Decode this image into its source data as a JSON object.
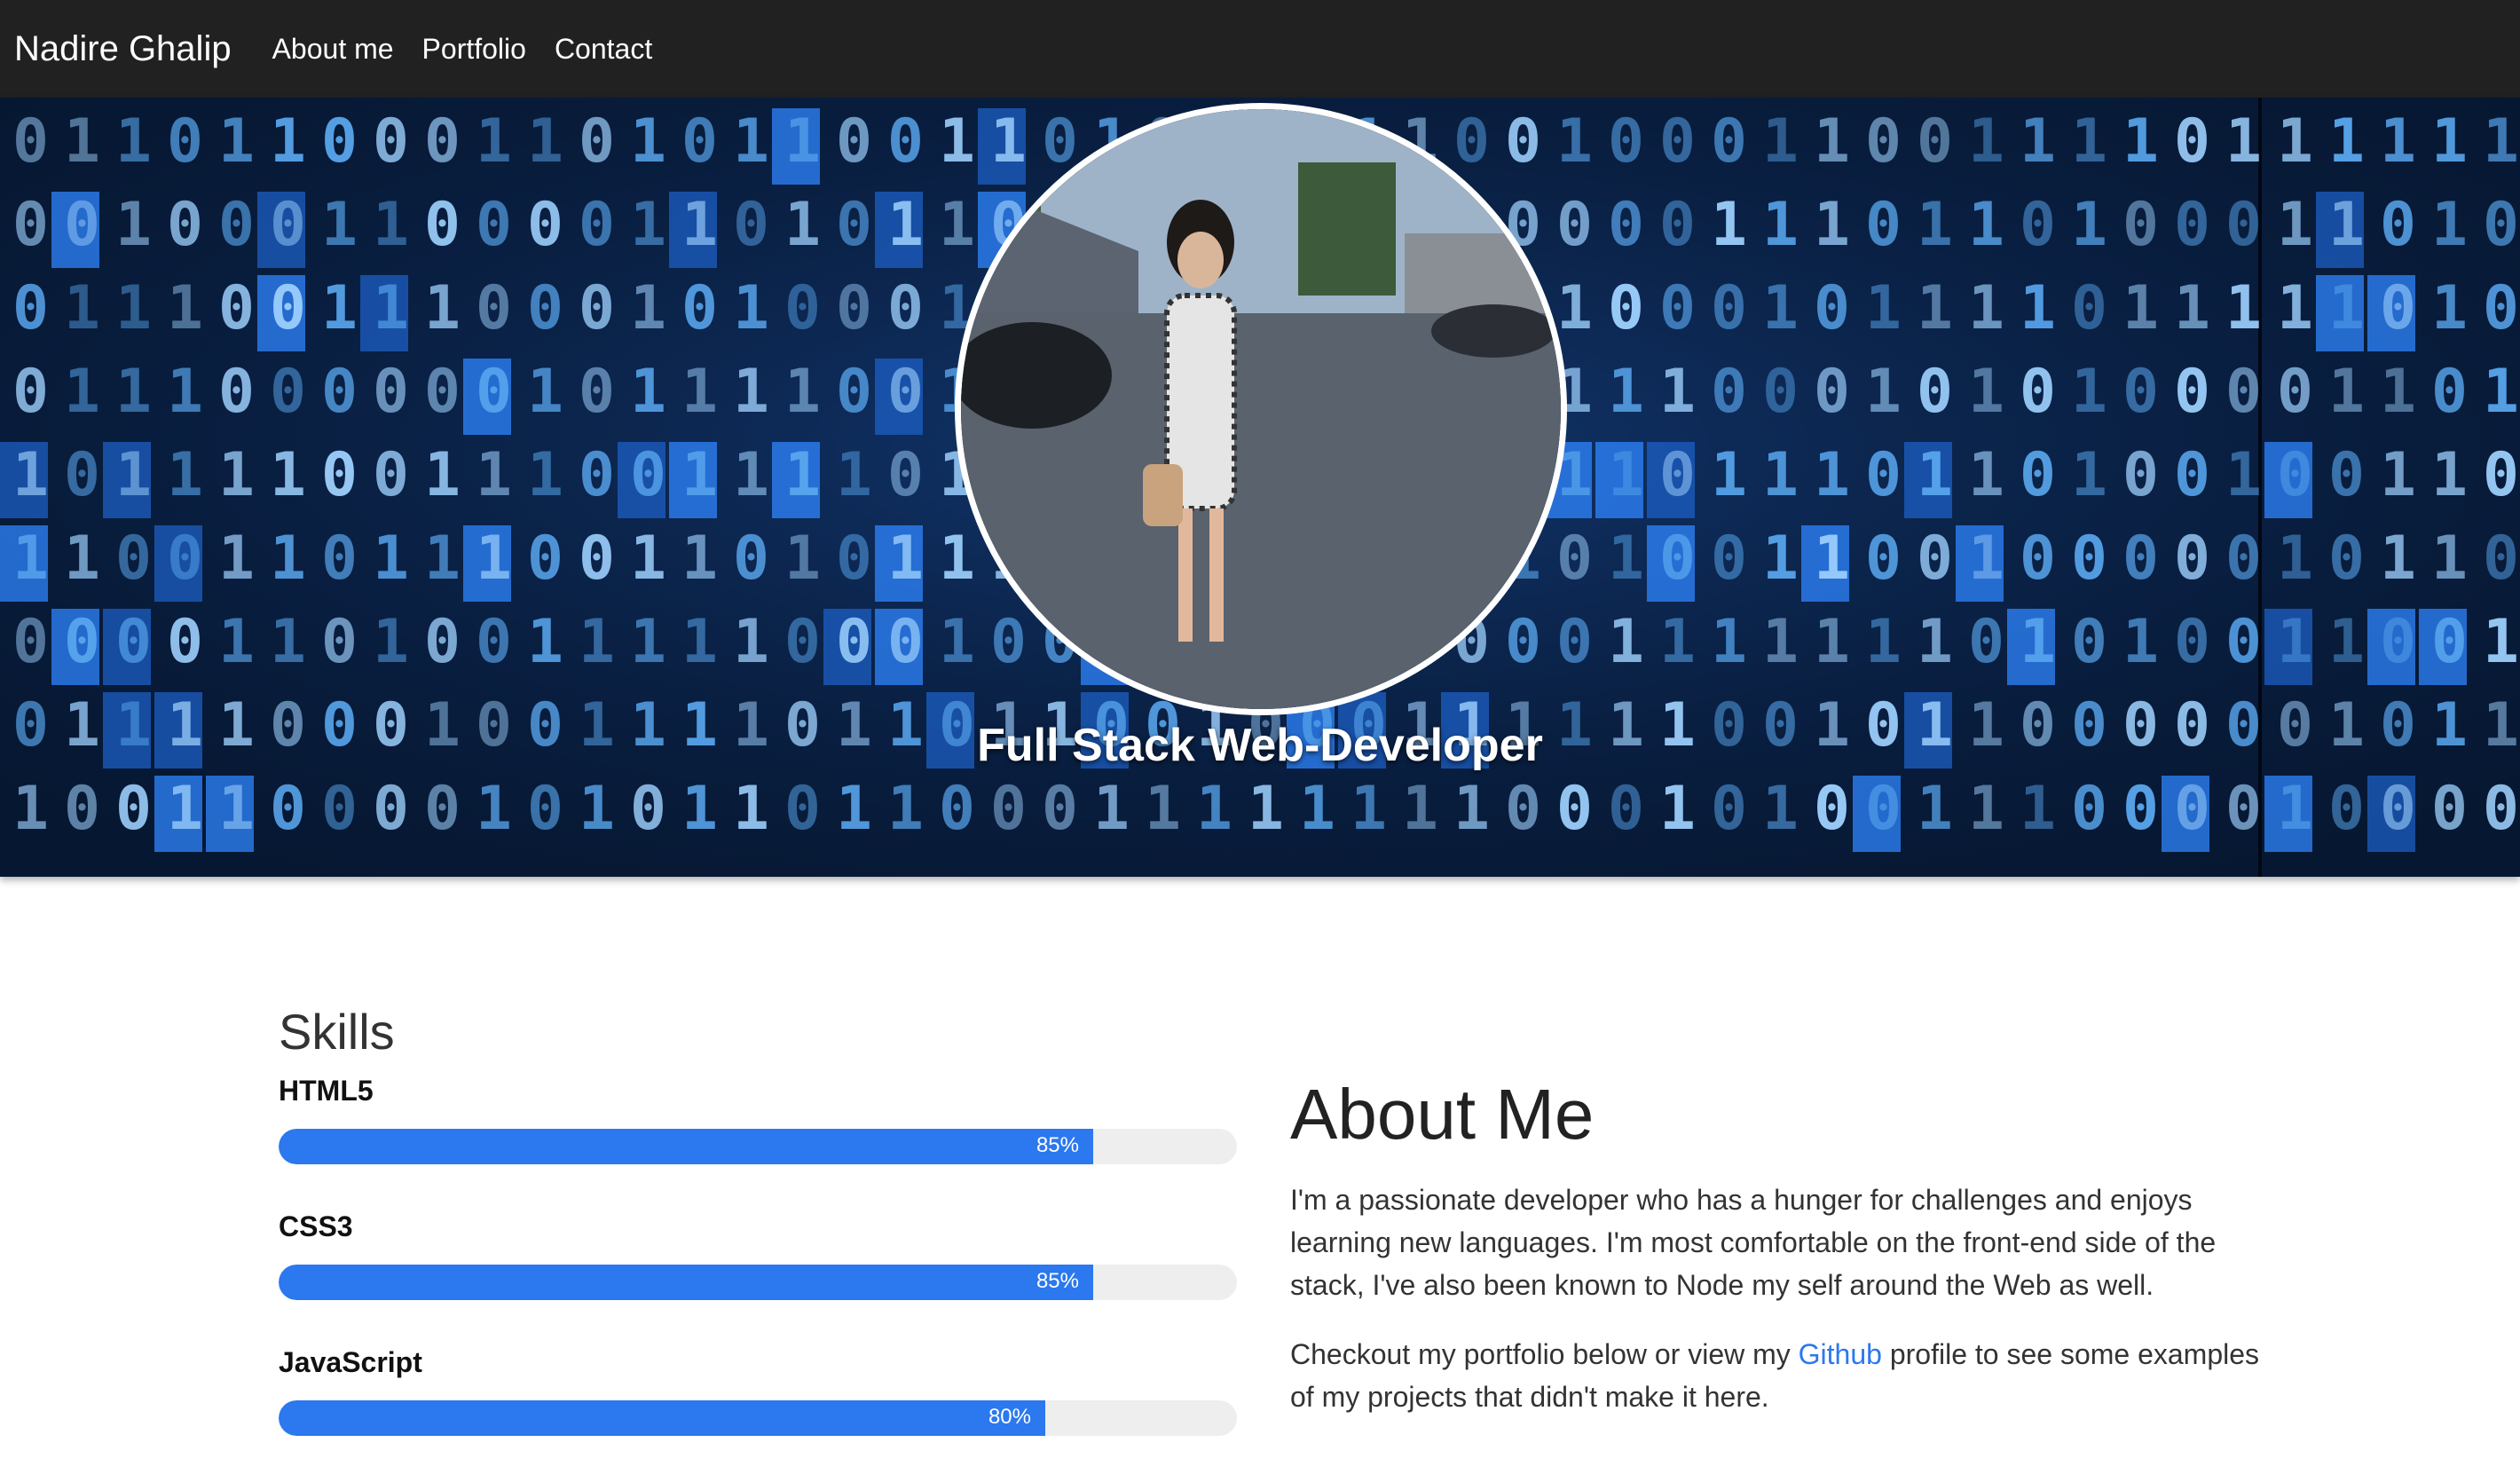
{
  "nav": {
    "brand": "Nadire Ghalip",
    "links": [
      "About me",
      "Portfolio",
      "Contact"
    ]
  },
  "hero": {
    "title": "Full Stack Web-Developer",
    "avatar_icon": "profile-photo-icon"
  },
  "skills": {
    "heading": "Skills",
    "items": [
      {
        "name": "HTML5",
        "percent": 85,
        "label": "85%"
      },
      {
        "name": "CSS3",
        "percent": 85,
        "label": "85%"
      },
      {
        "name": "JavaScript",
        "percent": 80,
        "label": "80%"
      }
    ]
  },
  "about": {
    "heading": "About Me",
    "p1": "I'm a passionate developer who has a hunger for challenges and enjoys learning new languages. I'm most comfortable on the front-end side of the stack, I've also been known to Node my self around the Web as well.",
    "p2_before": "Checkout my portfolio below or view my ",
    "p2_link": "Github",
    "p2_after": " profile to see some examples of my projects that didn't make it here."
  },
  "colors": {
    "navbar": "#212121",
    "accent": "#2b78ef",
    "bar_track": "#eeeeee"
  }
}
